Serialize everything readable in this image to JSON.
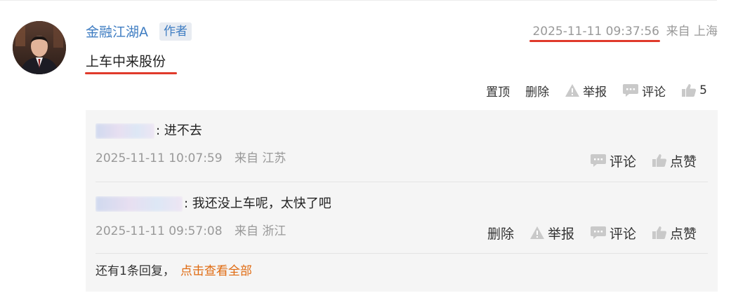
{
  "post": {
    "author": "金融江湖A",
    "badge": "作者",
    "time": "2025-11-11 09:37:56",
    "location": "来自 上海",
    "content": "上车中来股份",
    "actions": {
      "pin": "置顶",
      "delete": "删除",
      "report": "举报",
      "comment": "评论",
      "like_count": "5"
    },
    "colors": {
      "highlight_underline": "#e03a2b",
      "link": "#3f7dc2"
    }
  },
  "replies": [
    {
      "text": "进不去",
      "time": "2025-11-11 10:07:59",
      "location": "来自 江苏",
      "actions": {
        "comment": "评论",
        "like": "点赞"
      }
    },
    {
      "text": "我还没上车呢，太快了吧",
      "time": "2025-11-11 09:57:08",
      "location": "来自 浙江",
      "actions": {
        "delete": "删除",
        "report": "举报",
        "comment": "评论",
        "like": "点赞"
      }
    }
  ],
  "more": {
    "count_text": "还有1条回复，",
    "link_text": "点击查看全部",
    "link_color": "#e06a10"
  },
  "icons": {
    "report": "warning-triangle-icon",
    "comment": "speech-bubble-icon",
    "like": "thumbs-up-icon"
  }
}
